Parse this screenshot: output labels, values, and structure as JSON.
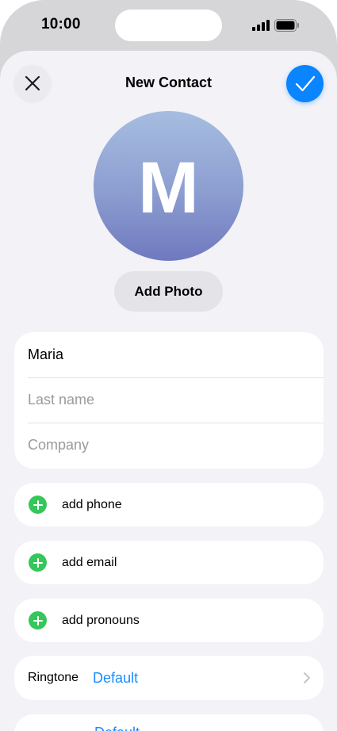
{
  "status_bar": {
    "time": "10:00",
    "signal_icon": "cellular-signal-icon",
    "battery_icon": "battery-icon"
  },
  "header": {
    "title": "New Contact",
    "close_icon": "close-icon",
    "done_icon": "checkmark-icon"
  },
  "avatar": {
    "initial": "M",
    "add_photo_label": "Add Photo"
  },
  "name_fields": {
    "first_name_value": "Maria",
    "last_name_placeholder": "Last name",
    "company_placeholder": "Company"
  },
  "add_rows": [
    {
      "label": "add phone",
      "icon": "plus-circle-icon"
    },
    {
      "label": "add email",
      "icon": "plus-circle-icon"
    },
    {
      "label": "add pronouns",
      "icon": "plus-circle-icon"
    }
  ],
  "ringtone": {
    "label": "Ringtone",
    "value": "Default",
    "chevron_icon": "chevron-right-icon"
  },
  "next_row": {
    "value": "Default"
  },
  "colors": {
    "accent": "#0a84ff",
    "link": "#1a8cff",
    "add_green": "#34c759",
    "sheet_background": "#f2f2f7",
    "avatar_gradient_top": "#a6bde0",
    "avatar_gradient_bottom": "#6f79bf"
  }
}
